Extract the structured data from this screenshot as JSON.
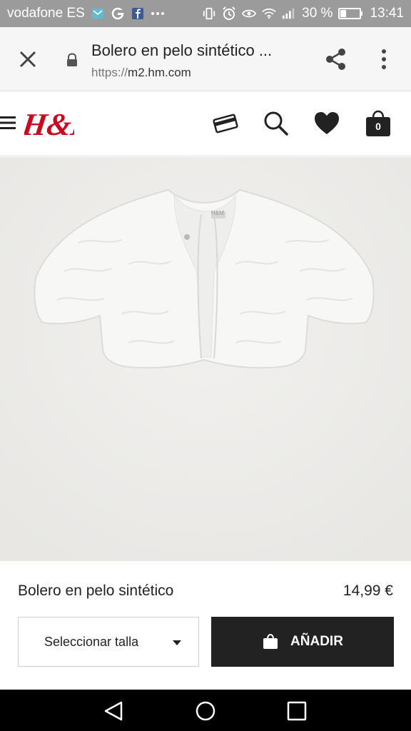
{
  "status_bar": {
    "carrier": "vodafone ES",
    "battery": "30 %",
    "time": "13:41",
    "icons_left": [
      "message-icon",
      "google-icon",
      "facebook-icon",
      "more-notifications-icon"
    ],
    "icons_right": [
      "vibrate-icon",
      "alarm-icon",
      "eye-icon",
      "wifi-icon",
      "signal-icon",
      "battery-icon"
    ]
  },
  "browser": {
    "title": "Bolero en pelo sintético ...",
    "url_protocol": "https://",
    "url_host": "m2.hm.com"
  },
  "site": {
    "logo_text": "H&M",
    "cart_count": "0",
    "brand_color": "#cc071e"
  },
  "product": {
    "name": "Bolero en pelo sintético",
    "price": "14,99 €",
    "size_placeholder": "Seleccionar talla",
    "add_label": "AÑADIR",
    "image_label": "H&M"
  }
}
